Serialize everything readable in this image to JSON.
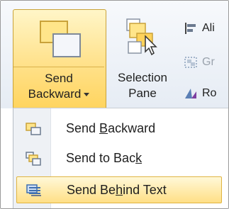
{
  "ribbon": {
    "send_backward": {
      "label_line1": "Send",
      "label_line2": "Backward"
    },
    "selection_pane": {
      "label_line1": "Selection",
      "label_line2": "Pane"
    },
    "align": {
      "label": "Ali"
    },
    "group": {
      "label": "Gr"
    },
    "rotate": {
      "label": "Ro"
    }
  },
  "menu": {
    "items": [
      {
        "pre": "Send ",
        "key": "B",
        "post": "ackward",
        "icon": "send-backward-icon"
      },
      {
        "pre": "Send to Bac",
        "key": "k",
        "post": "",
        "icon": "send-to-back-icon"
      },
      {
        "pre": "Send Be",
        "key": "h",
        "post": "ind Text",
        "icon": "send-behind-text-icon",
        "highlighted": true
      }
    ]
  },
  "colors": {
    "highlight": "#ffe18a",
    "highlight_border": "#c9a23a",
    "menu_gutter": "#eef1f5"
  }
}
